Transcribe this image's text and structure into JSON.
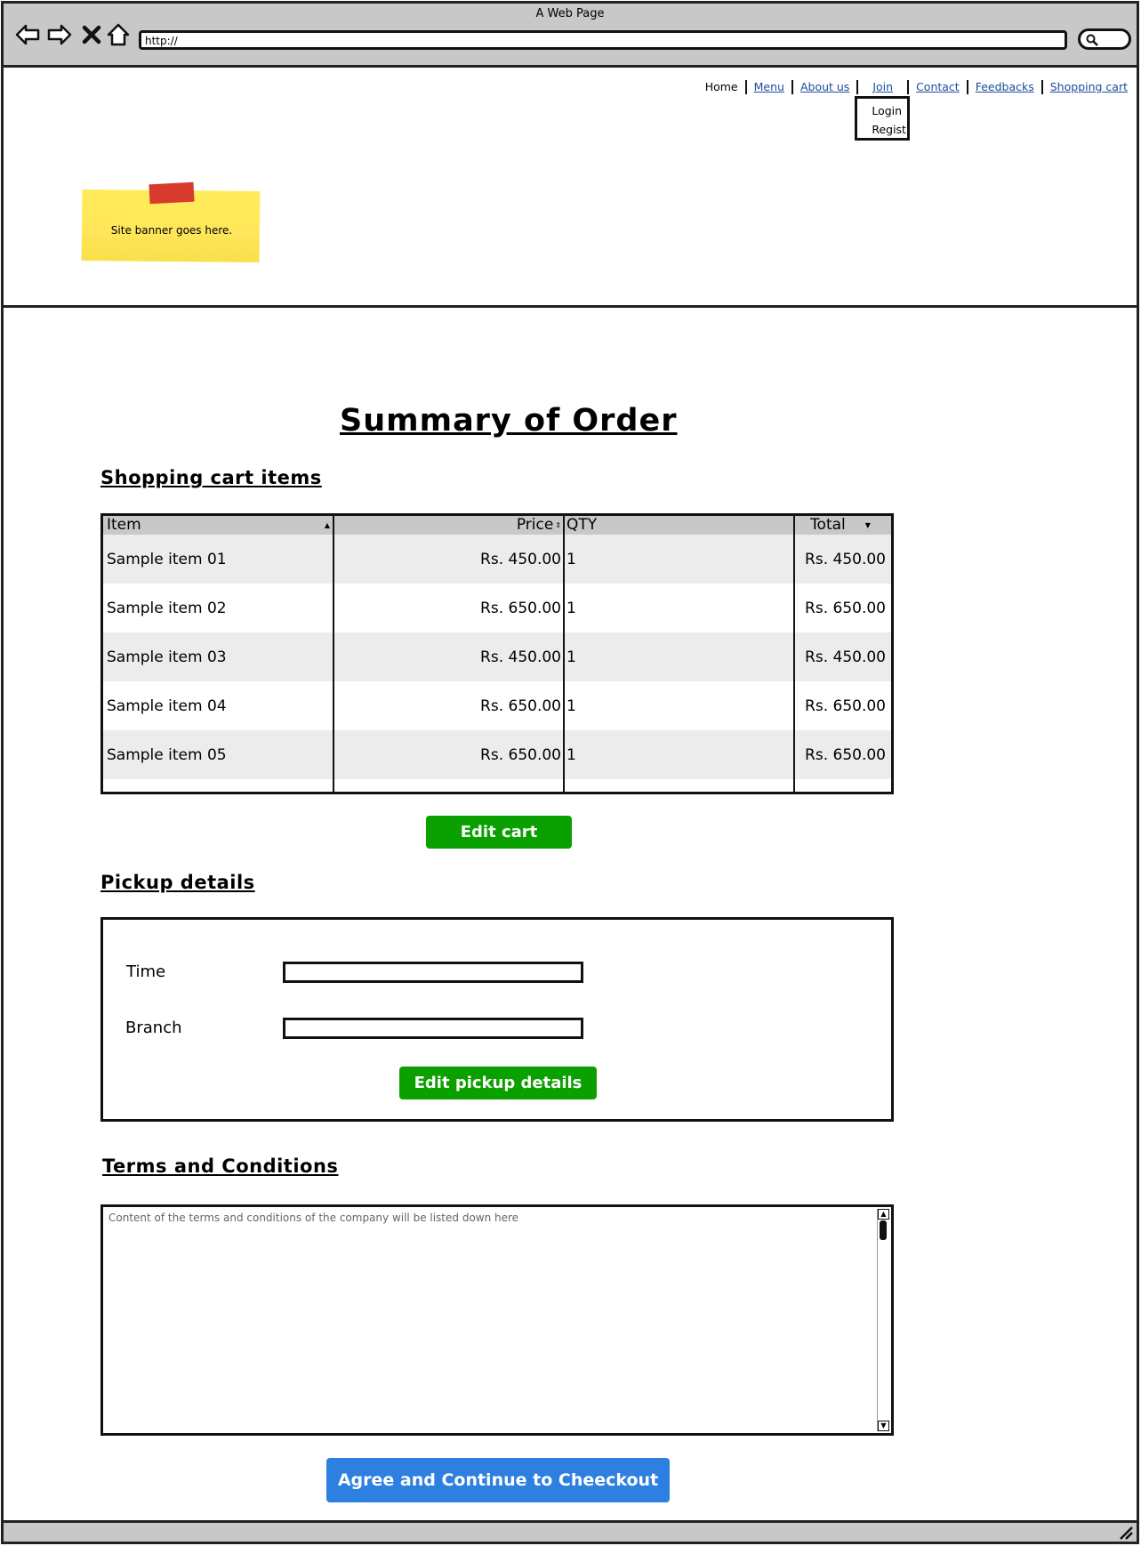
{
  "browser": {
    "title": "A Web Page",
    "url": "http://"
  },
  "nav": {
    "home": "Home",
    "menu": "Menu",
    "about": "About us",
    "join": "Join",
    "contact": "Contact",
    "feedbacks": "Feedbacks",
    "cart": "Shopping cart",
    "join_dropdown": [
      "Login",
      "Regist"
    ]
  },
  "banner": {
    "text": "Site banner goes here."
  },
  "page": {
    "title": "Summary of Order"
  },
  "cart": {
    "section_title": "Shopping cart items",
    "columns": [
      "Item",
      "Price",
      "QTY",
      "Total"
    ],
    "rows": [
      {
        "item": "Sample item 01",
        "price": "Rs. 450.00",
        "qty": "1",
        "total": "Rs. 450.00"
      },
      {
        "item": "Sample item 02",
        "price": "Rs. 650.00",
        "qty": "1",
        "total": "Rs. 650.00"
      },
      {
        "item": "Sample item 03",
        "price": "Rs. 450.00",
        "qty": "1",
        "total": "Rs. 450.00"
      },
      {
        "item": "Sample item 04",
        "price": "Rs. 650.00",
        "qty": "1",
        "total": "Rs. 650.00"
      },
      {
        "item": "Sample item 05",
        "price": "Rs. 650.00",
        "qty": "1",
        "total": "Rs. 650.00"
      }
    ],
    "edit_button": "Edit cart"
  },
  "pickup": {
    "section_title": "Pickup details",
    "time_label": "Time",
    "branch_label": "Branch",
    "time_value": "",
    "branch_value": "",
    "edit_button": "Edit pickup details"
  },
  "terms": {
    "section_title": "Terms and Conditions",
    "content": "Content of the terms and conditions of the company will be listed down here"
  },
  "checkout": {
    "button": "Agree and Continue to Cheeckout"
  },
  "colors": {
    "green_button": "#0aa000",
    "blue_button": "#2d7fe0",
    "sticky_note": "#ffe65a",
    "tape": "#d93a2e",
    "link": "#1a4d9e"
  }
}
